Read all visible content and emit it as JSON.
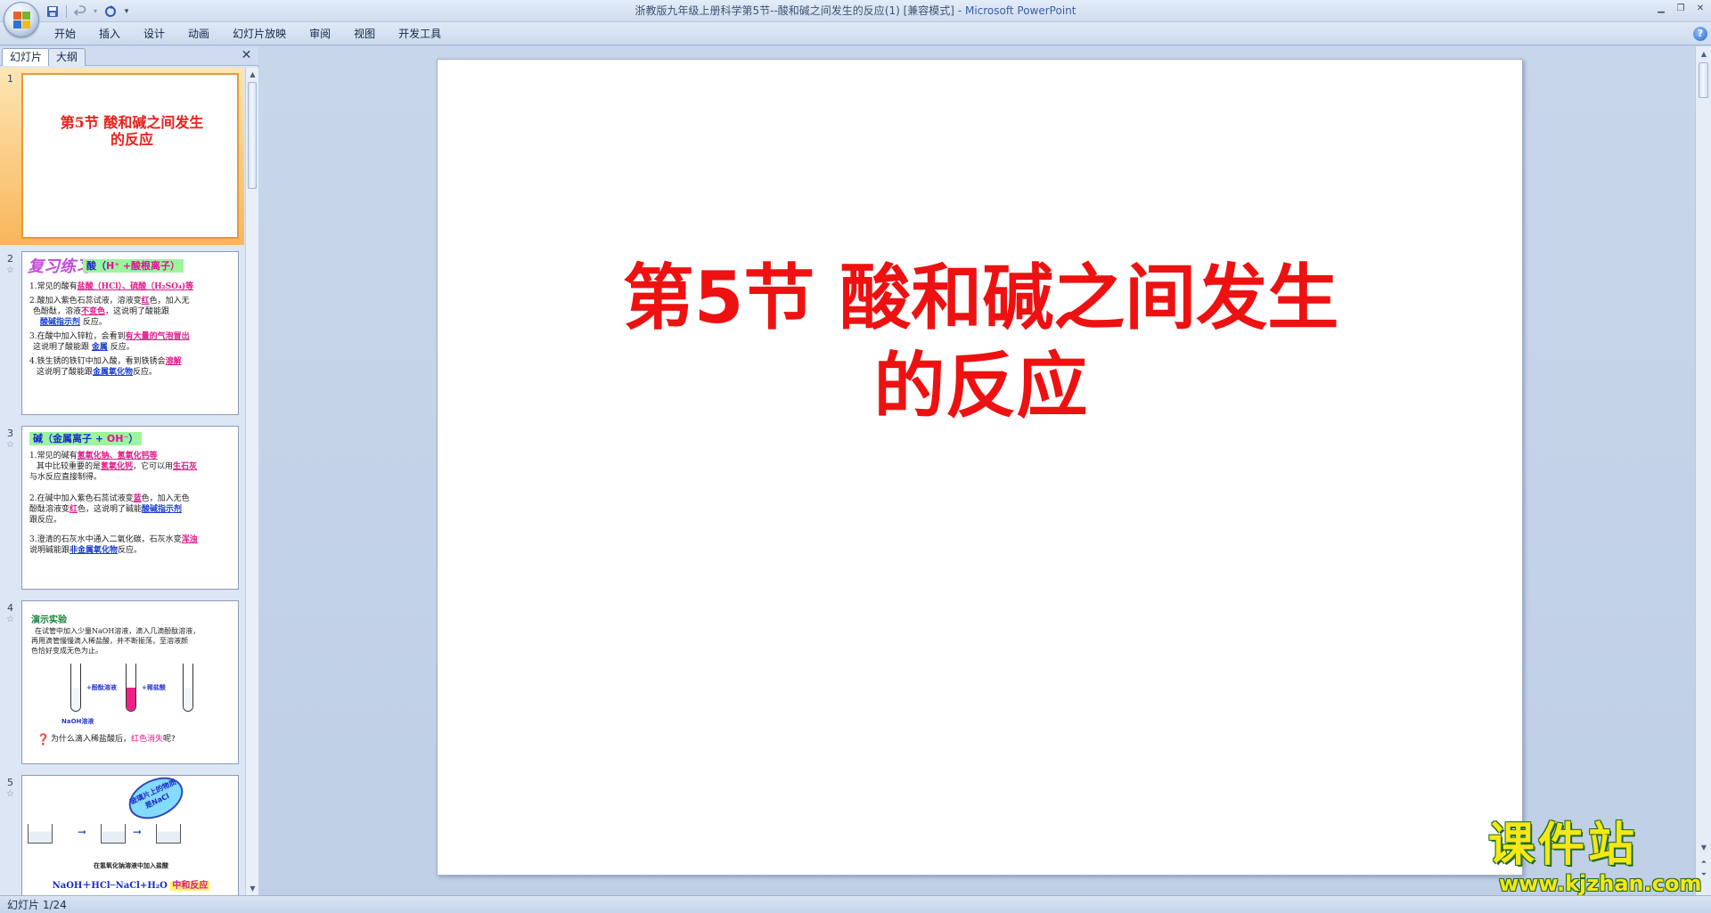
{
  "window": {
    "title": "浙教版九年级上册科学第5节--酸和碱之间发生的反应(1) [兼容模式]",
    "app_name": "Microsoft PowerPoint",
    "title_sep": " - "
  },
  "ribbon": {
    "tabs": [
      "开始",
      "插入",
      "设计",
      "动画",
      "幻灯片放映",
      "审阅",
      "视图",
      "开发工具"
    ]
  },
  "panel": {
    "tab_slides": "幻灯片",
    "tab_outline": "大纲"
  },
  "thumbnails": {
    "s1": {
      "num": "1",
      "title_line1": "第5节 酸和碱之间发生",
      "title_line2": "的反应"
    },
    "s2": {
      "num": "2",
      "heading": "复习练习:",
      "tag_a": "酸（",
      "tag_b": "H⁺",
      "tag_c": " +酸根离子）",
      "l1a": "1.常见的酸有",
      "l1b": "盐酸（HCl）、硫酸（H₂SO₄)等",
      "l2a": "2.酸加入紫色石蕊试液，溶液变",
      "l2b": "红",
      "l2c": "色，加入无",
      "l3a": "色酚酞，溶液",
      "l3b": "不变色",
      "l3c": "，这说明了酸能跟",
      "l4a": "",
      "l4b": "酸碱指示剂",
      "l4c": " 反应。",
      "l5a": "3.在酸中加入锌粒，会看到",
      "l5b": "有大量的气泡冒出",
      "l6a": "这说明了酸能跟 ",
      "l6b": "金属",
      "l6c": " 反应。",
      "l7a": "4.铁生锈的铁钉中加入酸，看到铁锈会",
      "l7b": "溶解",
      "l8a": "这说明了酸能跟",
      "l8b": "金属氧化物",
      "l8c": "反应。"
    },
    "s3": {
      "num": "3",
      "tag_a": "碱（金属离子 + ",
      "tag_b": "OH⁻",
      "tag_c": "）",
      "l1a": "1.常见的碱有",
      "l1b": "氢氧化钠、氢氧化钙等",
      "l2a": "其中比较重要的是",
      "l2b": "氢氧化钙",
      "l2c": "，它可以用",
      "l2d": "生石灰",
      "l3a": "与水反应直接制得。",
      "l4a": "2.在碱中加入紫色石蕊试液变",
      "l4b": "蓝",
      "l4c": "色，加入无色",
      "l5a": "酚酞溶液变",
      "l5b": "红",
      "l5c": "色，这说明了碱能",
      "l5d": "酸碱指示剂",
      "l6a": "跟反应。",
      "l7a": "3.澄清的石灰水中通入二氧化碳，石灰水变",
      "l7b": "浑浊",
      "l8a": "说明碱能跟",
      "l8b": "非金属氧化物",
      "l8c": "反应。"
    },
    "s4": {
      "num": "4",
      "title": "演示实验",
      "l1": "在试管中加入少量NaOH溶液，滴入几滴酚酞溶液，",
      "l2": "再用滴管慢慢滴入稀盐酸，并不断振荡，至溶液颜",
      "l3": "色恰好变成无色为止。",
      "label1": "+酚酞溶液",
      "label2": "+稀盐酸",
      "label3": "NaOH溶液",
      "q_a": "为什么滴入稀盐酸后，",
      "q_b": "红色消失",
      "q_c": "呢?"
    },
    "s5": {
      "num": "5",
      "bubble": "玻璃片上的物质是NaCl",
      "cap": "在氢氧化钠溶液中加入盐酸",
      "eq": "NaOH＋HCl─NaCl+H₂O",
      "eq_tag": "中和反应"
    }
  },
  "slide": {
    "title_pre": "第",
    "title_num": "5",
    "title_rest": "节 酸和碱之间发生",
    "title_line2": "的反应"
  },
  "watermark": {
    "brand": "课件站",
    "url": "www.kjzhan.com"
  },
  "statusbar": {
    "slide_info": "幻灯片 1/24"
  },
  "colors": {
    "title_red": "#ee1111",
    "selection_orange": "#f8b65b",
    "ribbon_blue": "#cddbef"
  }
}
